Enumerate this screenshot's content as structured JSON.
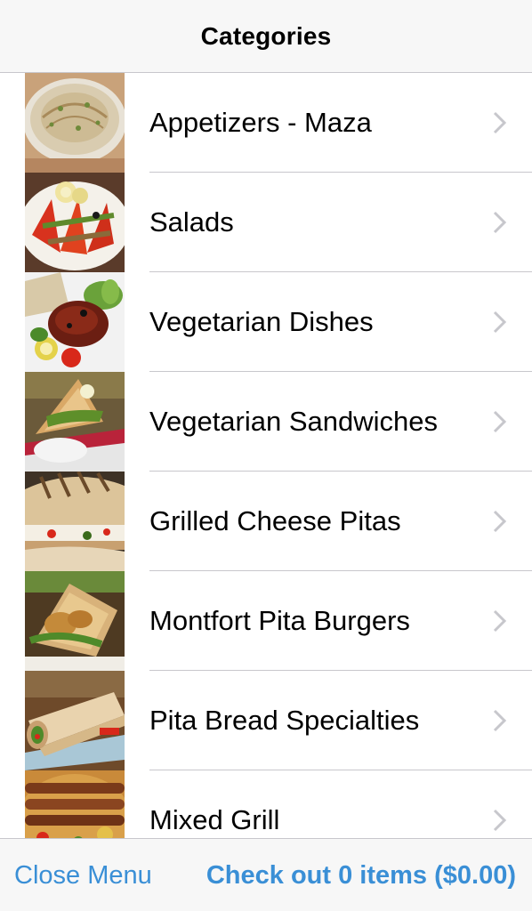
{
  "navbar": {
    "title": "Categories"
  },
  "categories": [
    {
      "label": "Appetizers - Maza",
      "thumb_icon": "hummus-plate-photo",
      "chevron_icon": "chevron-right-icon"
    },
    {
      "label": "Salads",
      "thumb_icon": "salad-photo",
      "chevron_icon": "chevron-right-icon"
    },
    {
      "label": "Vegetarian Dishes",
      "thumb_icon": "vegetarian-dish-photo",
      "chevron_icon": "chevron-right-icon"
    },
    {
      "label": "Vegetarian Sandwiches",
      "thumb_icon": "pita-sandwich-photo",
      "chevron_icon": "chevron-right-icon"
    },
    {
      "label": "Grilled Cheese Pitas",
      "thumb_icon": "grilled-pita-photo",
      "chevron_icon": "chevron-right-icon"
    },
    {
      "label": "Montfort Pita Burgers",
      "thumb_icon": "pita-burger-photo",
      "chevron_icon": "chevron-right-icon"
    },
    {
      "label": "Pita Bread Specialties",
      "thumb_icon": "pita-wrap-photo",
      "chevron_icon": "chevron-right-icon"
    },
    {
      "label": "Mixed Grill",
      "thumb_icon": "kebab-grill-photo",
      "chevron_icon": "chevron-right-icon"
    }
  ],
  "toolbar": {
    "close_label": "Close Menu",
    "checkout_label": "Check out 0 items ($0.00)"
  },
  "colors": {
    "accent": "#3a8fd6",
    "separator": "#c8c7cc",
    "bar_background": "#f7f7f7",
    "chevron": "#c7c7cc"
  }
}
